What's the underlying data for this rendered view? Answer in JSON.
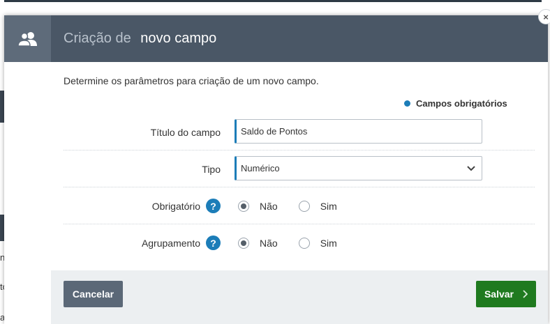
{
  "background": {
    "fragments": [
      "na",
      "to",
      "a"
    ]
  },
  "modal": {
    "title_prefix": "Criação de",
    "title_main": "novo campo",
    "header_icon": "users-icon",
    "close_label": "×",
    "intro": "Determine os parâmetros para criação de um novo campo.",
    "required_note": "Campos obrigatórios",
    "fields": {
      "titulo": {
        "label": "Título do campo",
        "value": "Saldo de Pontos"
      },
      "tipo": {
        "label": "Tipo",
        "value": "Numérico"
      },
      "obrigatorio": {
        "label": "Obrigatório",
        "help": "?",
        "option_no": "Não",
        "option_yes": "Sim",
        "selected": "Não"
      },
      "agrupamento": {
        "label": "Agrupamento",
        "help": "?",
        "option_no": "Não",
        "option_yes": "Sim",
        "selected": "Não"
      }
    },
    "footer": {
      "cancel_label": "Cancelar",
      "save_label": "Salvar"
    }
  },
  "colors": {
    "header_bg": "#4a5766",
    "accent": "#1c7db8",
    "save": "#1f7a1f",
    "cancel": "#5b6877"
  }
}
